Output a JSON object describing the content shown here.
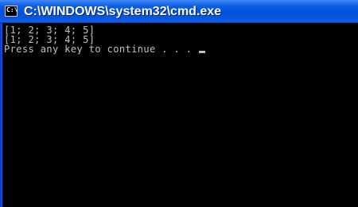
{
  "window": {
    "title": "C:\\WINDOWS\\system32\\cmd.exe",
    "icon": "cmd-console-icon",
    "icon_glyph": "C:\\"
  },
  "console": {
    "lines": [
      "[1; 2; 3; 4; 5]",
      "[1; 2; 3; 4; 5]",
      "Press any key to continue . . . "
    ],
    "text_color": "#c0c0c0",
    "background_color": "#000000"
  },
  "colors": {
    "titlebar_accent": "#0451dc",
    "title_text": "#ffffff"
  }
}
